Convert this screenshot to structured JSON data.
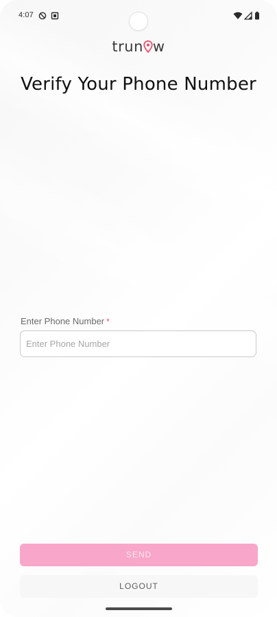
{
  "status_bar": {
    "time": "4:07",
    "left_icons": [
      "do-not-disturb-icon",
      "notification-icon"
    ],
    "right_icons": [
      "wifi-icon",
      "signal-icon",
      "battery-icon"
    ]
  },
  "logo": {
    "text_before": "trun",
    "text_after": "w",
    "pin_color": "#e9506d"
  },
  "page": {
    "title": "Verify Your Phone Number"
  },
  "phone_field": {
    "label": "Enter Phone Number",
    "required_mark": "*",
    "placeholder": "Enter Phone Number",
    "value": ""
  },
  "actions": {
    "send_label": "SEND",
    "logout_label": "LOGOUT"
  },
  "colors": {
    "accent": "#f8a6c9",
    "required": "#e9506d"
  }
}
